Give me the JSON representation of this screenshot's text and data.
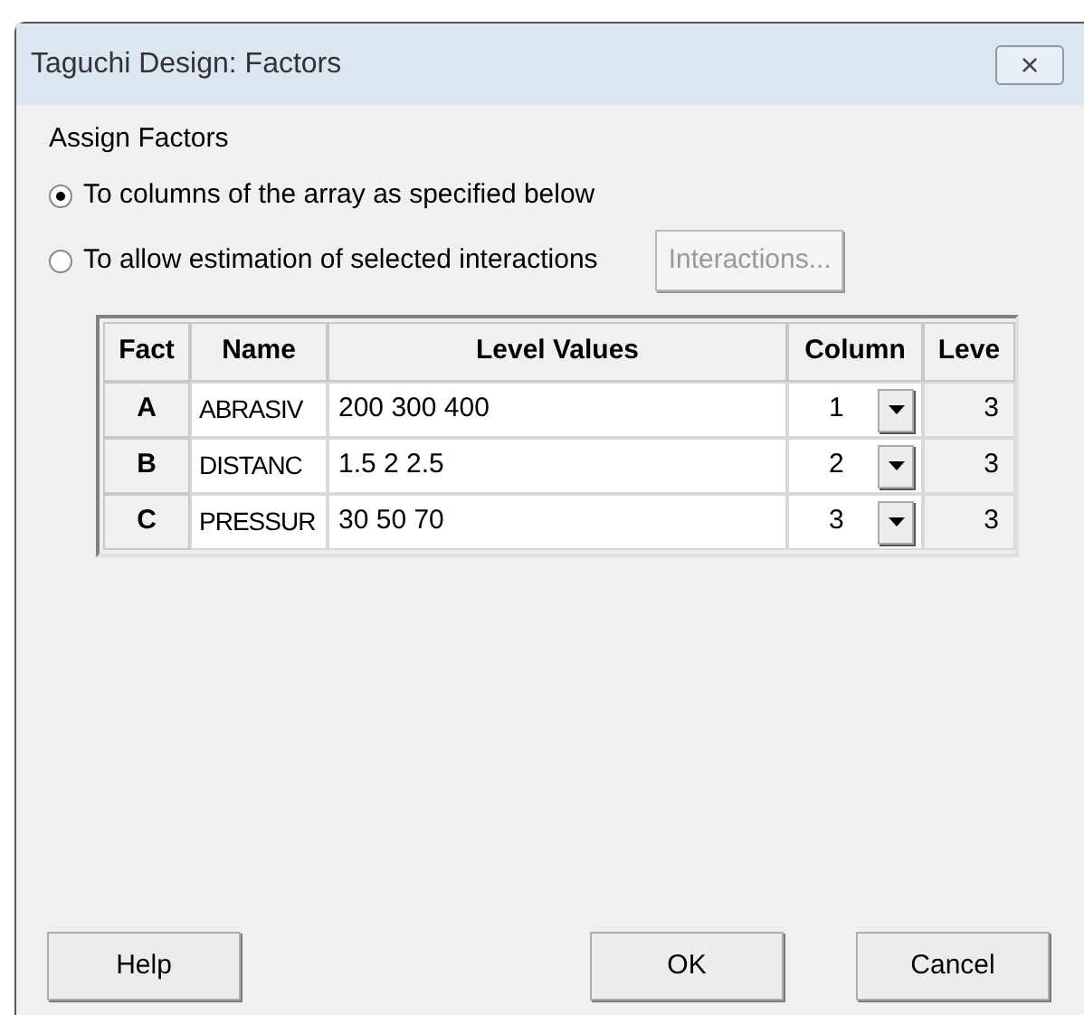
{
  "window": {
    "title": "Taguchi Design: Factors",
    "close": "×"
  },
  "group_label": "Assign Factors",
  "options": [
    {
      "label": "To columns of the array as specified below",
      "selected": true
    },
    {
      "label": "To allow estimation of selected interactions",
      "selected": false
    }
  ],
  "interactions_button": {
    "label": "Interactions...",
    "disabled": true
  },
  "table": {
    "columns": [
      "Fact",
      "Name",
      "Level Values",
      "Column",
      "Leve"
    ],
    "rows": [
      {
        "factor": "A",
        "name": "ABRASIV",
        "levels": "200 300 400",
        "column": "1",
        "count": "3"
      },
      {
        "factor": "B",
        "name": "DISTANC",
        "levels": "1.5 2 2.5",
        "column": "2",
        "count": "3"
      },
      {
        "factor": "C",
        "name": "PRESSUR",
        "levels": "30 50 70",
        "column": "3",
        "count": "3"
      }
    ]
  },
  "buttons": {
    "help": "Help",
    "ok": "OK",
    "cancel": "Cancel"
  }
}
